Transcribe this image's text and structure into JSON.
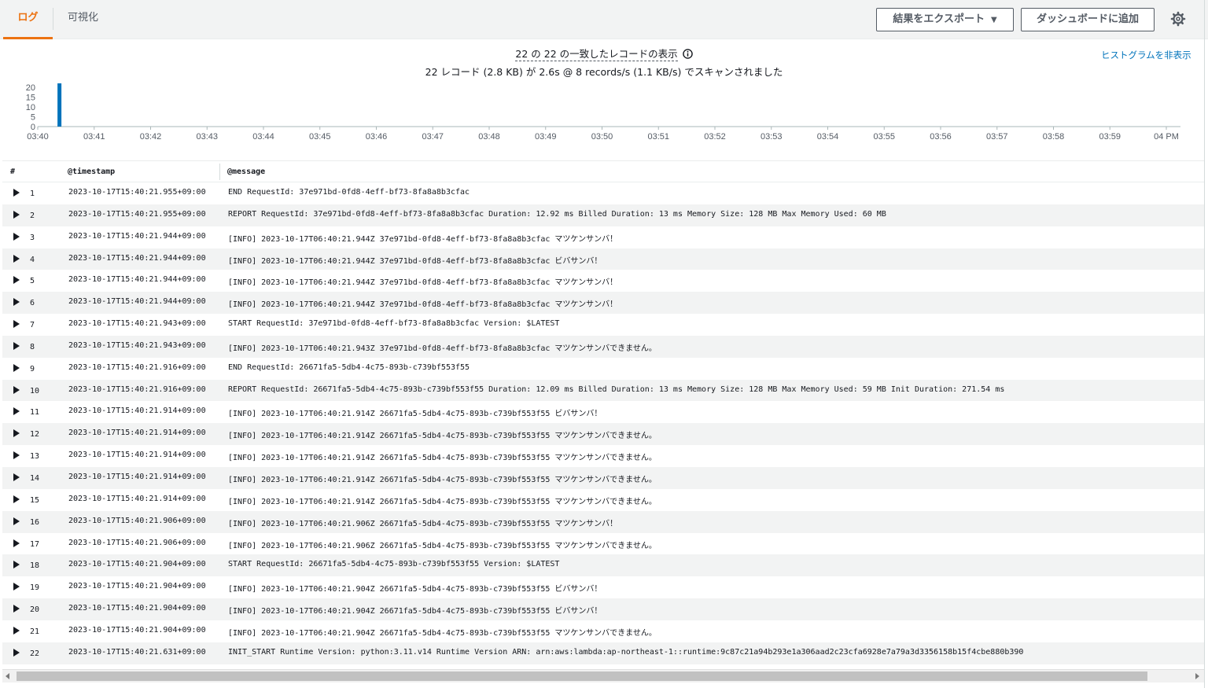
{
  "tabs": {
    "logs": "ログ",
    "visualization": "可視化"
  },
  "toolbar": {
    "export_label": "結果をエクスポート",
    "export_caret": "▼",
    "dashboard_label": "ダッシュボードに追加"
  },
  "summary": {
    "line1": "22 の 22 の一致したレコードの表示",
    "line2": "22 レコード (2.8 KB) が 2.6s @ 8 records/s (1.1 KB/s) でスキャンされました"
  },
  "hide_histogram": "ヒストグラムを非表示",
  "chart_data": {
    "type": "bar",
    "x_ticks": [
      "03:40",
      "03:41",
      "03:42",
      "03:43",
      "03:44",
      "03:45",
      "03:46",
      "03:47",
      "03:48",
      "03:49",
      "03:50",
      "03:51",
      "03:52",
      "03:53",
      "03:54",
      "03:55",
      "03:56",
      "03:57",
      "03:58",
      "03:59",
      "04 PM"
    ],
    "y_ticks": [
      "20",
      "15",
      "10",
      "5",
      "0"
    ],
    "ylim": [
      0,
      20
    ],
    "bars": [
      {
        "x": "03:40:21",
        "value": 22
      }
    ],
    "colors": {
      "bar": "#0073bb",
      "axis": "#aab7b8",
      "text": "#545b64"
    }
  },
  "table": {
    "columns": {
      "num": "#",
      "timestamp": "@timestamp",
      "message": "@message"
    },
    "rows": [
      {
        "num": "1",
        "timestamp": "2023-10-17T15:40:21.955+09:00",
        "message": "END RequestId: 37e971bd-0fd8-4eff-bf73-8fa8a8b3cfac"
      },
      {
        "num": "2",
        "timestamp": "2023-10-17T15:40:21.955+09:00",
        "message": "REPORT RequestId: 37e971bd-0fd8-4eff-bf73-8fa8a8b3cfac Duration: 12.92 ms Billed Duration: 13 ms Memory Size: 128 MB Max Memory Used: 60 MB"
      },
      {
        "num": "3",
        "timestamp": "2023-10-17T15:40:21.944+09:00",
        "message": "[INFO] 2023-10-17T06:40:21.944Z 37e971bd-0fd8-4eff-bf73-8fa8a8b3cfac マツケンサンバ！"
      },
      {
        "num": "4",
        "timestamp": "2023-10-17T15:40:21.944+09:00",
        "message": "[INFO] 2023-10-17T06:40:21.944Z 37e971bd-0fd8-4eff-bf73-8fa8a8b3cfac ビバサンバ！"
      },
      {
        "num": "5",
        "timestamp": "2023-10-17T15:40:21.944+09:00",
        "message": "[INFO] 2023-10-17T06:40:21.944Z 37e971bd-0fd8-4eff-bf73-8fa8a8b3cfac マツケンサンバ！"
      },
      {
        "num": "6",
        "timestamp": "2023-10-17T15:40:21.944+09:00",
        "message": "[INFO] 2023-10-17T06:40:21.944Z 37e971bd-0fd8-4eff-bf73-8fa8a8b3cfac マツケンサンバ！"
      },
      {
        "num": "7",
        "timestamp": "2023-10-17T15:40:21.943+09:00",
        "message": "START RequestId: 37e971bd-0fd8-4eff-bf73-8fa8a8b3cfac Version: $LATEST"
      },
      {
        "num": "8",
        "timestamp": "2023-10-17T15:40:21.943+09:00",
        "message": "[INFO] 2023-10-17T06:40:21.943Z 37e971bd-0fd8-4eff-bf73-8fa8a8b3cfac マツケンサンバできません。"
      },
      {
        "num": "9",
        "timestamp": "2023-10-17T15:40:21.916+09:00",
        "message": "END RequestId: 26671fa5-5db4-4c75-893b-c739bf553f55"
      },
      {
        "num": "10",
        "timestamp": "2023-10-17T15:40:21.916+09:00",
        "message": "REPORT RequestId: 26671fa5-5db4-4c75-893b-c739bf553f55 Duration: 12.09 ms Billed Duration: 13 ms Memory Size: 128 MB Max Memory Used: 59 MB Init Duration: 271.54 ms"
      },
      {
        "num": "11",
        "timestamp": "2023-10-17T15:40:21.914+09:00",
        "message": "[INFO] 2023-10-17T06:40:21.914Z 26671fa5-5db4-4c75-893b-c739bf553f55 ビバサンバ！"
      },
      {
        "num": "12",
        "timestamp": "2023-10-17T15:40:21.914+09:00",
        "message": "[INFO] 2023-10-17T06:40:21.914Z 26671fa5-5db4-4c75-893b-c739bf553f55 マツケンサンバできません。"
      },
      {
        "num": "13",
        "timestamp": "2023-10-17T15:40:21.914+09:00",
        "message": "[INFO] 2023-10-17T06:40:21.914Z 26671fa5-5db4-4c75-893b-c739bf553f55 マツケンサンバできません。"
      },
      {
        "num": "14",
        "timestamp": "2023-10-17T15:40:21.914+09:00",
        "message": "[INFO] 2023-10-17T06:40:21.914Z 26671fa5-5db4-4c75-893b-c739bf553f55 マツケンサンバできません。"
      },
      {
        "num": "15",
        "timestamp": "2023-10-17T15:40:21.914+09:00",
        "message": "[INFO] 2023-10-17T06:40:21.914Z 26671fa5-5db4-4c75-893b-c739bf553f55 マツケンサンバできません。"
      },
      {
        "num": "16",
        "timestamp": "2023-10-17T15:40:21.906+09:00",
        "message": "[INFO] 2023-10-17T06:40:21.906Z 26671fa5-5db4-4c75-893b-c739bf553f55 マツケンサンバ！"
      },
      {
        "num": "17",
        "timestamp": "2023-10-17T15:40:21.906+09:00",
        "message": "[INFO] 2023-10-17T06:40:21.906Z 26671fa5-5db4-4c75-893b-c739bf553f55 マツケンサンバできません。"
      },
      {
        "num": "18",
        "timestamp": "2023-10-17T15:40:21.904+09:00",
        "message": "START RequestId: 26671fa5-5db4-4c75-893b-c739bf553f55 Version: $LATEST"
      },
      {
        "num": "19",
        "timestamp": "2023-10-17T15:40:21.904+09:00",
        "message": "[INFO] 2023-10-17T06:40:21.904Z 26671fa5-5db4-4c75-893b-c739bf553f55 ビバサンバ！"
      },
      {
        "num": "20",
        "timestamp": "2023-10-17T15:40:21.904+09:00",
        "message": "[INFO] 2023-10-17T06:40:21.904Z 26671fa5-5db4-4c75-893b-c739bf553f55 ビバサンバ！"
      },
      {
        "num": "21",
        "timestamp": "2023-10-17T15:40:21.904+09:00",
        "message": "[INFO] 2023-10-17T06:40:21.904Z 26671fa5-5db4-4c75-893b-c739bf553f55 マツケンサンバできません。"
      },
      {
        "num": "22",
        "timestamp": "2023-10-17T15:40:21.631+09:00",
        "message": "INIT_START Runtime Version: python:3.11.v14 Runtime Version ARN: arn:aws:lambda:ap-northeast-1::runtime:9c87c21a94b293e1a306aad2c23cfa6928e7a79a3d3356158b15f4cbe880b390"
      }
    ]
  },
  "colors": {
    "accent": "#ec7211",
    "link": "#0073bb",
    "row_alt": "#f2f3f3"
  }
}
